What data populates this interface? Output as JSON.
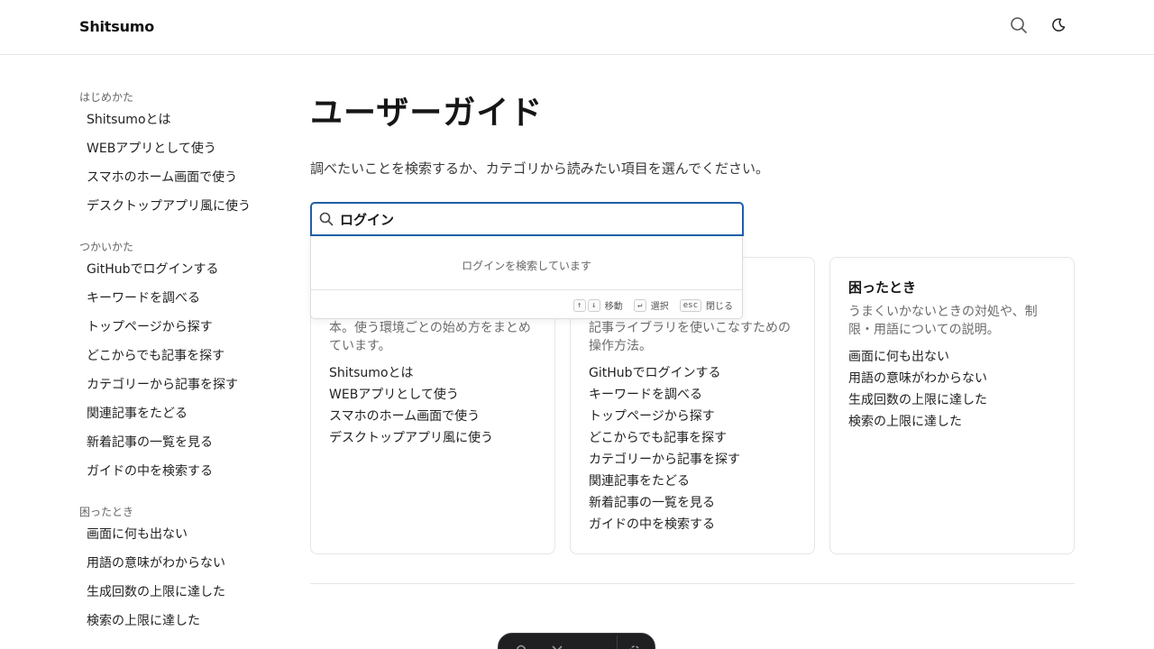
{
  "header": {
    "brand": "Shitsumo",
    "search_icon": "search-icon",
    "theme_icon": "moon-icon"
  },
  "sidebar": {
    "groups": [
      {
        "heading": "はじめかた",
        "items": [
          "Shitsumoとは",
          "WEBアプリとして使う",
          "スマホのホーム画面で使う",
          "デスクトップアプリ風に使う"
        ]
      },
      {
        "heading": "つかいかた",
        "items": [
          "GitHubでログインする",
          "キーワードを調べる",
          "トップページから探す",
          "どこからでも記事を探す",
          "カテゴリーから記事を探す",
          "関連記事をたどる",
          "新着記事の一覧を見る",
          "ガイドの中を検索する"
        ]
      },
      {
        "heading": "困ったとき",
        "items": [
          "画面に何も出ない",
          "用語の意味がわからない",
          "生成回数の上限に達した",
          "検索の上限に達した"
        ]
      }
    ]
  },
  "main": {
    "title": "ユーザーガイド",
    "lead": "調べたいことを検索するか、カテゴリから読みたい項目を選んでください。"
  },
  "search": {
    "value": "ログイン",
    "status": "ログインを検索しています",
    "hints": [
      {
        "keys": [
          "↑",
          "↓"
        ],
        "label": "移動"
      },
      {
        "keys": [
          "↵"
        ],
        "label": "選択"
      },
      {
        "keys": [
          "esc"
        ],
        "label": "閉じる"
      }
    ]
  },
  "cards": [
    {
      "title": "",
      "desc_visible": "本。使う環境ごとの始め方をまとめています。",
      "links": [
        "Shitsumoとは",
        "WEBアプリとして使う",
        "スマホのホーム画面で使う",
        "デスクトップアプリ風に使う"
      ]
    },
    {
      "title": "",
      "desc_visible": "記事ライブラリを使いこなすための操作方法。",
      "links": [
        "GitHubでログインする",
        "キーワードを調べる",
        "トップページから探す",
        "どこからでも記事を探す",
        "カテゴリーから記事を探す",
        "関連記事をたどる",
        "新着記事の一覧を見る",
        "ガイドの中を検索する"
      ]
    },
    {
      "title": "困ったとき",
      "desc_visible": "うまくいかないときの対処や、制限・用語についての説明。",
      "links": [
        "画面に何も出ない",
        "用語の意味がわからない",
        "生成回数の上限に達した",
        "検索の上限に達した"
      ]
    }
  ],
  "colors": {
    "accent": "#1f5fa8",
    "toolbar_bg": "#1f1f22"
  }
}
